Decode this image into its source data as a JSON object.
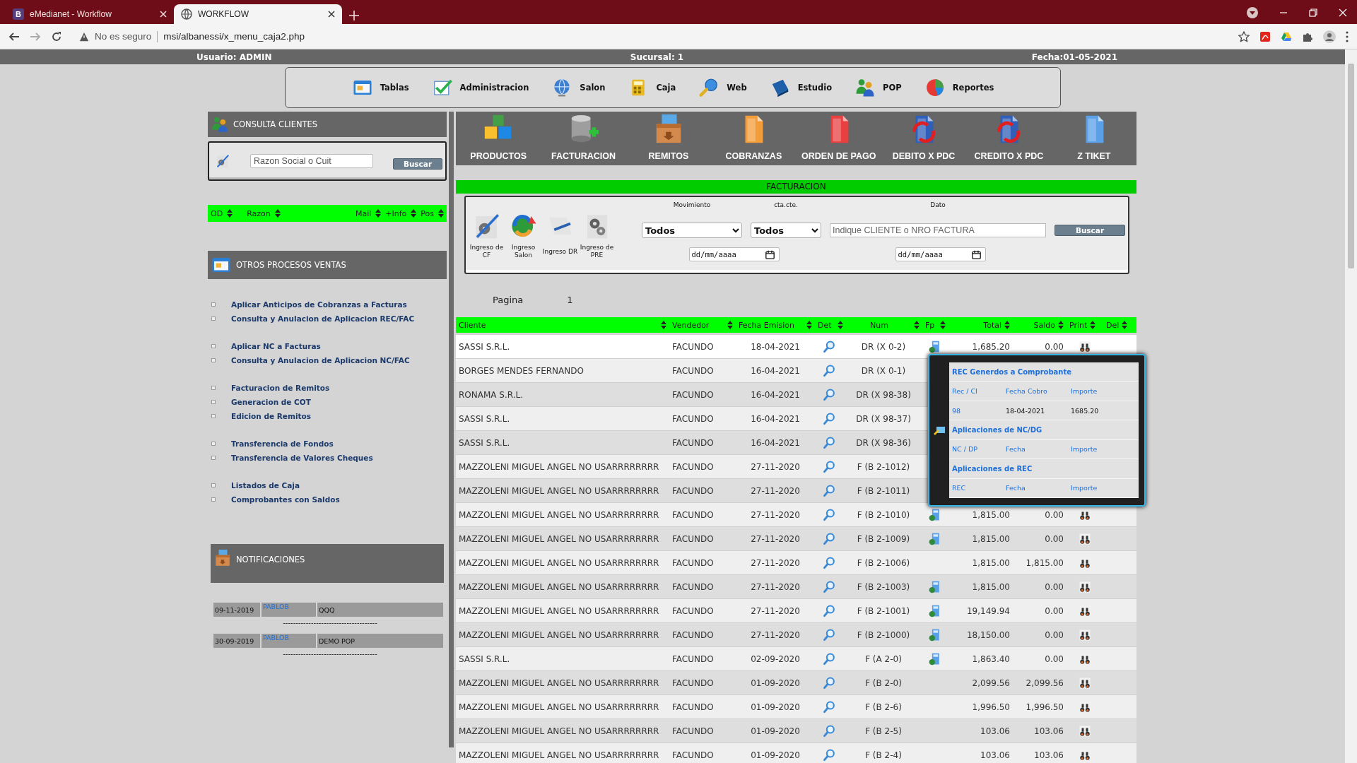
{
  "browser": {
    "tabs": [
      {
        "favicon": "B",
        "title": "eMedianet - Workflow",
        "selected": false
      },
      {
        "title": "WORKFLOW",
        "selected": true
      }
    ],
    "address": {
      "security": "No es seguro",
      "url": "msi/albanessi/x_menu_caja2.php"
    }
  },
  "info_bar": {
    "user": "Usuario: ADMIN",
    "branch": "Sucursal: 1",
    "date": "Fecha:01-05-2021"
  },
  "main_menu": [
    "Tablas",
    "Administracion",
    "Salon",
    "Caja",
    "Web",
    "Estudio",
    "POP",
    "Reportes"
  ],
  "clients_panel": {
    "title": "CONSULTA CLIENTES",
    "search": {
      "placeholder": "Razon Social o Cuit"
    },
    "button": "Buscar",
    "columns": [
      "OD",
      "Razon",
      "Mail",
      "+Info",
      "Pos"
    ]
  },
  "sales_panel": {
    "title": "OTROS PROCESOS VENTAS",
    "groups": [
      [
        "Aplicar Anticipos de Cobranzas a Facturas",
        "Consulta y Anulacion de Aplicacion REC/FAC"
      ],
      [
        "Aplicar NC a Facturas",
        "Consulta y Anulacion de Aplicacion NC/FAC"
      ],
      [
        "Facturacion de Remitos",
        "Generacion de COT",
        "Edicion de Remitos"
      ],
      [
        "Transferencia de Fondos",
        "Transferencia de Valores Cheques"
      ],
      [
        "Listados de Caja",
        "Comprobantes con Saldos"
      ]
    ]
  },
  "notifications": {
    "title": "NOTIFICACIONES",
    "items": [
      {
        "date": "09-11-2019",
        "user": "PABLOB",
        "text": "QQQ",
        "separator": "-------------------------------------"
      },
      {
        "date": "30-09-2019",
        "user": "PABLOB",
        "text": "DEMO POP",
        "separator": "-------------------------------------"
      }
    ]
  },
  "toolbar": [
    "PRODUCTOS",
    "FACTURACION",
    "REMITOS",
    "COBRANZAS",
    "ORDEN DE PAGO",
    "DEBITO X PDC",
    "CREDITO X PDC",
    "Z TIKET"
  ],
  "section_title": "FACTURACION",
  "filters": {
    "entries": [
      "Ingreso de CF",
      "Ingreso Salon",
      "Ingreso DR",
      "Ingreso de PRE"
    ],
    "movement": {
      "label": "Movimiento",
      "value": "Todos"
    },
    "account": {
      "label": "cta.cte.",
      "value": "Todos"
    },
    "query": {
      "label": "Dato",
      "placeholder": "Indique CLIENTE o NRO FACTURA"
    },
    "button": "Buscar",
    "date_from": {
      "placeholder": "dd/mm/aaaa"
    },
    "date_to": {
      "placeholder": "dd/mm/aaaa"
    }
  },
  "pager": {
    "label": "Pagina",
    "page": "1"
  },
  "table": {
    "columns": [
      "Cliente",
      "Vendedor",
      "Fecha Emision",
      "Det",
      "Num",
      "Fp",
      "Total",
      "Saldo",
      "Print",
      "Del"
    ],
    "rows": [
      {
        "client": "SASSI S.R.L.",
        "seller": "FACUNDO",
        "date": "18-04-2021",
        "num": "DR (X 0-2)",
        "fp": true,
        "total": "1,685.20",
        "balance": "0.00",
        "print": true
      },
      {
        "client": "BORGES MENDES FERNANDO",
        "seller": "FACUNDO",
        "date": "16-04-2021",
        "num": "DR (X 0-1)"
      },
      {
        "client": "RONAMA S.R.L.",
        "seller": "FACUNDO",
        "date": "16-04-2021",
        "num": "DR (X 98-38)"
      },
      {
        "client": "SASSI S.R.L.",
        "seller": "FACUNDO",
        "date": "16-04-2021",
        "num": "DR (X 98-37)"
      },
      {
        "client": "SASSI S.R.L.",
        "seller": "FACUNDO",
        "date": "16-04-2021",
        "num": "DR (X 98-36)"
      },
      {
        "client": "MAZZOLENI MIGUEL ANGEL NO USARRRRRRRR",
        "seller": "FACUNDO",
        "date": "27-11-2020",
        "num": "F (B 2-1012)"
      },
      {
        "client": "MAZZOLENI MIGUEL ANGEL NO USARRRRRRRR",
        "seller": "FACUNDO",
        "date": "27-11-2020",
        "num": "F (B 2-1011)"
      },
      {
        "client": "MAZZOLENI MIGUEL ANGEL NO USARRRRRRRR",
        "seller": "FACUNDO",
        "date": "27-11-2020",
        "num": "F (B 2-1010)",
        "fp": true,
        "total": "1,815.00",
        "balance": "0.00",
        "print": true
      },
      {
        "client": "MAZZOLENI MIGUEL ANGEL NO USARRRRRRRR",
        "seller": "FACUNDO",
        "date": "27-11-2020",
        "num": "F (B 2-1009)",
        "fp": true,
        "total": "1,815.00",
        "balance": "0.00",
        "print": true
      },
      {
        "client": "MAZZOLENI MIGUEL ANGEL NO USARRRRRRRR",
        "seller": "FACUNDO",
        "date": "27-11-2020",
        "num": "F (B 2-1006)",
        "fp": false,
        "total": "1,815.00",
        "balance": "1,815.00",
        "print": true
      },
      {
        "client": "MAZZOLENI MIGUEL ANGEL NO USARRRRRRRR",
        "seller": "FACUNDO",
        "date": "27-11-2020",
        "num": "F (B 2-1003)",
        "fp": true,
        "total": "1,815.00",
        "balance": "0.00",
        "print": true
      },
      {
        "client": "MAZZOLENI MIGUEL ANGEL NO USARRRRRRRR",
        "seller": "FACUNDO",
        "date": "27-11-2020",
        "num": "F (B 2-1001)",
        "fp": true,
        "total": "19,149.94",
        "balance": "0.00",
        "print": true
      },
      {
        "client": "MAZZOLENI MIGUEL ANGEL NO USARRRRRRRR",
        "seller": "FACUNDO",
        "date": "27-11-2020",
        "num": "F (B 2-1000)",
        "fp": true,
        "total": "18,150.00",
        "balance": "0.00",
        "print": true
      },
      {
        "client": "SASSI S.R.L.",
        "seller": "FACUNDO",
        "date": "02-09-2020",
        "num": "F (A 2-0)",
        "fp": true,
        "total": "1,863.40",
        "balance": "0.00",
        "print": true
      },
      {
        "client": "MAZZOLENI MIGUEL ANGEL NO USARRRRRRRR",
        "seller": "FACUNDO",
        "date": "01-09-2020",
        "num": "F (B 2-0)",
        "fp": false,
        "total": "2,099.56",
        "balance": "2,099.56",
        "print": true
      },
      {
        "client": "MAZZOLENI MIGUEL ANGEL NO USARRRRRRRR",
        "seller": "FACUNDO",
        "date": "01-09-2020",
        "num": "F (B 2-6)",
        "fp": false,
        "total": "1,996.50",
        "balance": "1,996.50",
        "print": true
      },
      {
        "client": "MAZZOLENI MIGUEL ANGEL NO USARRRRRRRR",
        "seller": "FACUNDO",
        "date": "01-09-2020",
        "num": "F (B 2-5)",
        "fp": false,
        "total": "103.06",
        "balance": "103.06",
        "print": true
      },
      {
        "client": "MAZZOLENI MIGUEL ANGEL NO USARRRRRRRR",
        "seller": "FACUNDO",
        "date": "01-09-2020",
        "num": "F (B 2-4)",
        "fp": false,
        "total": "103.06",
        "balance": "103.06",
        "print": true
      }
    ]
  },
  "popover": {
    "sections": [
      {
        "title": "REC Generdos a Comprobante",
        "header": [
          "Rec / CI",
          "Fecha Cobro",
          "Importe"
        ],
        "rows": [
          [
            "98",
            "18-04-2021",
            "1685.20"
          ]
        ]
      },
      {
        "title": "Aplicaciones de NC/DG",
        "header": [
          "NC / DP",
          "Fecha",
          "Importe"
        ]
      },
      {
        "title": "Aplicaciones de REC",
        "header": [
          "REC",
          "Fecha",
          "Importe"
        ]
      }
    ]
  }
}
